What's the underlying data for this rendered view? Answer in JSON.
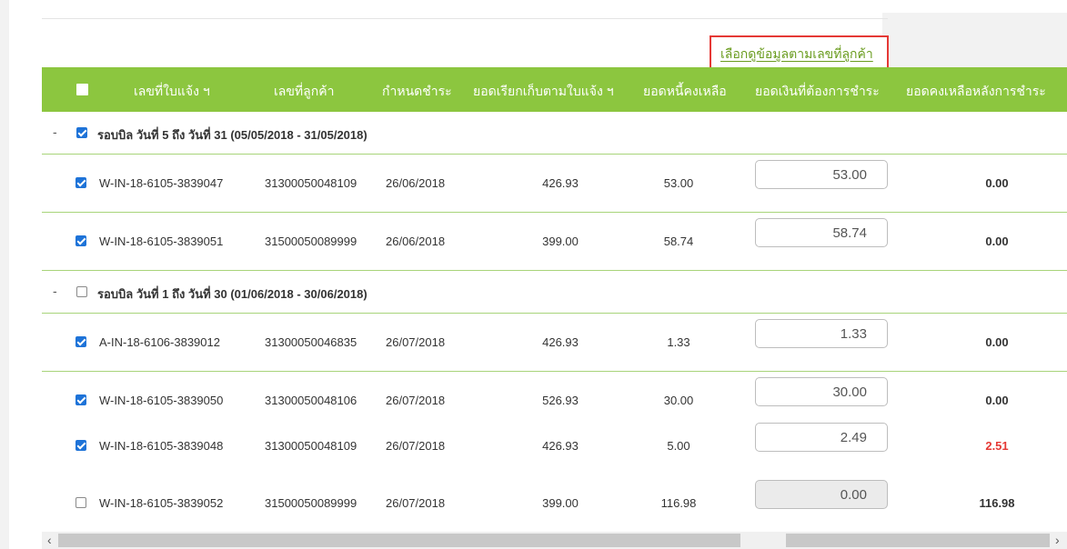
{
  "link": {
    "label": "เลือกดูข้อมูลตามเลขที่ลูกค้า"
  },
  "headers": {
    "invoice_no": "เลขที่ใบแจ้ง ฯ",
    "customer_no": "เลขที่ลูกค้า",
    "due_date": "กำหนดชำระ",
    "billed_amount": "ยอดเรียกเก็บตามใบแจ้ง ฯ",
    "outstanding": "ยอดหนี้คงเหลือ",
    "pay_amount": "ยอดเงินที่ต้องการชำระ",
    "balance_after": "ยอดคงเหลือหลังการชำระ"
  },
  "groups": [
    {
      "dash": "-",
      "checked": true,
      "title": "รอบบิล วันที่ 5 ถึง วันที่ 31 (05/05/2018 - 31/05/2018)",
      "rows": [
        {
          "checked": true,
          "invoice": "W-IN-18-6105-3839047",
          "customer": "31300050048109",
          "due": "26/06/2018",
          "billed": "426.93",
          "outstanding": "53.00",
          "pay": "53.00",
          "balance": "0.00",
          "disabled": false
        },
        {
          "checked": true,
          "invoice": "W-IN-18-6105-3839051",
          "customer": "31500050089999",
          "due": "26/06/2018",
          "billed": "399.00",
          "outstanding": "58.74",
          "pay": "58.74",
          "balance": "0.00",
          "disabled": false
        }
      ]
    },
    {
      "dash": "-",
      "checked": false,
      "title": "รอบบิล วันที่ 1 ถึง วันที่ 30 (01/06/2018 - 30/06/2018)",
      "rows": [
        {
          "checked": true,
          "invoice": "A-IN-18-6106-3839012",
          "customer": "31300050046835",
          "due": "26/07/2018",
          "billed": "426.93",
          "outstanding": "1.33",
          "pay": "1.33",
          "balance": "0.00",
          "disabled": false
        },
        {
          "checked": true,
          "invoice": "W-IN-18-6105-3839050",
          "customer": "31300050048106",
          "due": "26/07/2018",
          "billed": "526.93",
          "outstanding": "30.00",
          "pay": "30.00",
          "balance": "0.00",
          "disabled": false
        },
        {
          "checked": true,
          "invoice": "W-IN-18-6105-3839048",
          "customer": "31300050048109",
          "due": "26/07/2018",
          "billed": "426.93",
          "outstanding": "5.00",
          "pay": "2.49",
          "balance": "2.51",
          "disabled": false
        },
        {
          "checked": false,
          "invoice": "W-IN-18-6105-3839052",
          "customer": "31500050089999",
          "due": "26/07/2018",
          "billed": "399.00",
          "outstanding": "116.98",
          "pay": "0.00",
          "balance": "116.98",
          "disabled": true
        }
      ]
    }
  ],
  "scroll": {
    "left_arrow": "‹",
    "right_arrow": "›"
  },
  "colors": {
    "header_bg": "#8cc63f",
    "link": "#6a9c1f",
    "highlight_border": "#e53935",
    "negative_balance": "#e53935",
    "checkbox": "#1e73d8"
  }
}
